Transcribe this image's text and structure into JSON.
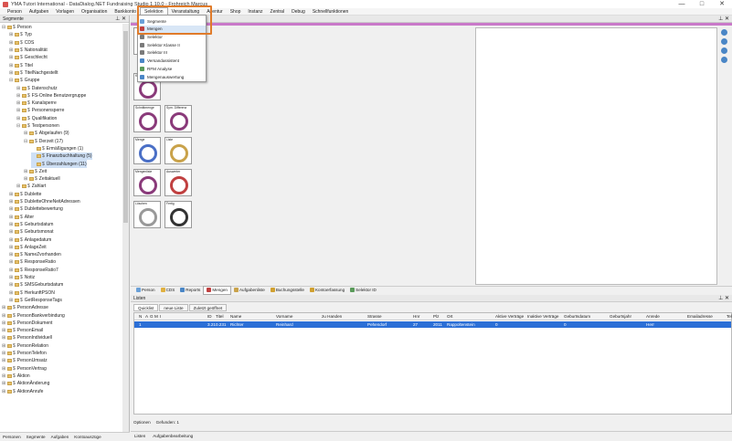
{
  "window": {
    "title": "YMA Tutori International - DataDialog.NET Fundraising Studio 1.10.0 - Frohreich Marcus",
    "controls": [
      "—",
      "□",
      "✕"
    ]
  },
  "menu": {
    "items": [
      "Person",
      "Aufgaben",
      "Vorlagen",
      "Organisation",
      "Bankkonto",
      "Selektion",
      "Veranstaltung",
      "Agentur",
      "Shop",
      "Instanz",
      "Zentral",
      "Debug",
      "Schnellfunktionen"
    ],
    "active_index": 5
  },
  "selektion_menu": {
    "items": [
      {
        "label": "Segmente",
        "icon_color": "#6aa0d8"
      },
      {
        "label": "Mengen",
        "icon_color": "#c04040"
      },
      {
        "label": "Selektor",
        "icon_color": "#7a7a7a"
      },
      {
        "label": "Selektor Klasse II",
        "icon_color": "#7a7a7a"
      },
      {
        "label": "Selektor III",
        "icon_color": "#7a7a7a"
      },
      {
        "label": "Versandassistent",
        "icon_color": "#4a86c6"
      },
      {
        "label": "RFM Analyse",
        "icon_color": "#5a9a5a"
      },
      {
        "label": "Mengenauswertung",
        "icon_color": "#4a86c6"
      }
    ],
    "hot_index": 1
  },
  "left_panel": {
    "title": "Segmente",
    "tree": [
      {
        "label": "Person",
        "depth": 0,
        "exp": "⊟"
      },
      {
        "label": "Typ",
        "depth": 1,
        "exp": "⊞"
      },
      {
        "label": "CDS",
        "depth": 1,
        "exp": "⊞"
      },
      {
        "label": "Nationalität",
        "depth": 1,
        "exp": "⊞"
      },
      {
        "label": "Geschlecht",
        "depth": 1,
        "exp": "⊞"
      },
      {
        "label": "Titel",
        "depth": 1,
        "exp": "⊞"
      },
      {
        "label": "TitelNachgestellt",
        "depth": 1,
        "exp": "⊞"
      },
      {
        "label": "Gruppe",
        "depth": 1,
        "exp": "⊟"
      },
      {
        "label": "Datenschutz",
        "depth": 2,
        "exp": "⊞"
      },
      {
        "label": "FS-Online Benutzergruppe",
        "depth": 2,
        "exp": "⊞"
      },
      {
        "label": "Kanalsperre",
        "depth": 2,
        "exp": "⊞"
      },
      {
        "label": "Personensperre",
        "depth": 2,
        "exp": "⊞"
      },
      {
        "label": "Qualifikation",
        "depth": 2,
        "exp": "⊞"
      },
      {
        "label": "Testpersonen",
        "depth": 2,
        "exp": "⊟"
      },
      {
        "label": "Abgelaufen (9)",
        "depth": 3,
        "exp": "⊞"
      },
      {
        "label": "Derzeit (17)",
        "depth": 3,
        "exp": "⊟"
      },
      {
        "label": "Ermäßigungen (1)",
        "depth": 4,
        "exp": ""
      },
      {
        "label": "Finanzbuchhaltung (5)",
        "depth": 4,
        "exp": "",
        "sel": true
      },
      {
        "label": "Überzahlungen (11)",
        "depth": 4,
        "exp": "",
        "sel": true
      },
      {
        "label": "Zeit",
        "depth": 3,
        "exp": "⊞"
      },
      {
        "label": "Zeitaktuell",
        "depth": 3,
        "exp": "⊞"
      },
      {
        "label": "Zahlart",
        "depth": 2,
        "exp": "⊞"
      },
      {
        "label": "Dublette",
        "depth": 1,
        "exp": "⊞"
      },
      {
        "label": "DubletteOhneNeitAdressen",
        "depth": 1,
        "exp": "⊞"
      },
      {
        "label": "Dublettebewertung",
        "depth": 1,
        "exp": "⊞"
      },
      {
        "label": "Alter",
        "depth": 1,
        "exp": "⊞"
      },
      {
        "label": "Geburtsdatum",
        "depth": 1,
        "exp": "⊞"
      },
      {
        "label": "Geburtsmonat",
        "depth": 1,
        "exp": "⊞"
      },
      {
        "label": "Anlagedatum",
        "depth": 1,
        "exp": "⊞"
      },
      {
        "label": "AnlageZeit",
        "depth": 1,
        "exp": "⊞"
      },
      {
        "label": "NameZvorhanden",
        "depth": 1,
        "exp": "⊞"
      },
      {
        "label": "ResponseRatio",
        "depth": 1,
        "exp": "⊞"
      },
      {
        "label": "ResponseRatio7",
        "depth": 1,
        "exp": "⊞"
      },
      {
        "label": "Notiz",
        "depth": 1,
        "exp": "⊞"
      },
      {
        "label": "SMSGeburtsdatum",
        "depth": 1,
        "exp": "⊞"
      },
      {
        "label": "HerkunftPSON",
        "depth": 1,
        "exp": "⊞"
      },
      {
        "label": "GetResponseTags",
        "depth": 1,
        "exp": "⊞"
      },
      {
        "label": "PersonAdresse",
        "depth": 0,
        "exp": "⊞"
      },
      {
        "label": "PersonBankverbindung",
        "depth": 0,
        "exp": "⊞"
      },
      {
        "label": "PersonDokument",
        "depth": 0,
        "exp": "⊞"
      },
      {
        "label": "PersonEmail",
        "depth": 0,
        "exp": "⊞"
      },
      {
        "label": "PersonIndividuell",
        "depth": 0,
        "exp": "⊞"
      },
      {
        "label": "PersonRelation",
        "depth": 0,
        "exp": "⊞"
      },
      {
        "label": "PersonTelefon",
        "depth": 0,
        "exp": "⊞"
      },
      {
        "label": "PersonUmsatz",
        "depth": 0,
        "exp": "⊞"
      },
      {
        "label": "PersonVertrag",
        "depth": 0,
        "exp": "⊞"
      },
      {
        "label": "Aktion",
        "depth": 0,
        "exp": "⊞"
      },
      {
        "label": "AktionÄnderung",
        "depth": 0,
        "exp": "⊞"
      },
      {
        "label": "AktionAnrufe",
        "depth": 0,
        "exp": "⊞"
      }
    ],
    "bottom_tabs": [
      "Personen",
      "Segmente",
      "Aufgaben",
      "Kontoauszüge"
    ]
  },
  "palette": {
    "tiles": [
      {
        "label": "",
        "col": 0,
        "row": 0,
        "color": "#8a3a7a"
      },
      {
        "label": "Kompl...",
        "col": 0,
        "row": 1,
        "color": "#8a3a7a"
      },
      {
        "label": "Schnittmenge",
        "col": 0,
        "row": 2,
        "color": "#8a3a7a"
      },
      {
        "label": "Sym. Differenz",
        "col": 1,
        "row": 2,
        "color": "#8a3a7a"
      },
      {
        "label": "Menge",
        "col": 0,
        "row": 3,
        "color": "#4a6fc6"
      },
      {
        "label": "Liste",
        "col": 1,
        "row": 3,
        "color": "#c9a24a"
      },
      {
        "label": "Mengenliste",
        "col": 0,
        "row": 4,
        "color": "#8a3a7a"
      },
      {
        "label": "Auswerter",
        "col": 1,
        "row": 4,
        "color": "#c04040"
      },
      {
        "label": "Löschen",
        "col": 0,
        "row": 5,
        "color": "#999999"
      },
      {
        "label": "Fertig",
        "col": 1,
        "row": 5,
        "color": "#333333"
      }
    ]
  },
  "tabstrip": {
    "tabs": [
      {
        "label": "Person",
        "color": "#6aa0d8"
      },
      {
        "label": "CDS",
        "color": "#e0b040"
      },
      {
        "label": "Reports",
        "color": "#4a86c6"
      },
      {
        "label": "Mengen",
        "color": "#c04040",
        "active": true
      },
      {
        "label": "Aufgabenliste",
        "color": "#c9a24a"
      },
      {
        "label": "Buchungsstelle",
        "color": "#d0a030"
      },
      {
        "label": "Kontoerfassung",
        "color": "#d0a030"
      },
      {
        "label": "Selektor ID",
        "color": "#5a9a5a"
      }
    ]
  },
  "lists": {
    "title": "Listen",
    "subtabs": [
      "Quicklist",
      "neue Liste",
      "Zuletzt geöffnet"
    ],
    "headers": [
      "N",
      "A",
      "G",
      "M",
      "I",
      "ID",
      "Titel",
      "Name",
      "Vorname",
      "zu Handen",
      "Strasse",
      "Hnr",
      "Plz",
      "Ort",
      "Aktive Verträge",
      "Inaktive Verträge",
      "Geburtsdatum",
      "Geburtsjahr",
      "Anrede",
      "Emailadresse",
      "Tel"
    ],
    "rows": [
      [
        "1",
        "",
        "",
        "",
        "",
        "3.210.231",
        "",
        "Richter",
        "Reinhard",
        "",
        "Pehendorf",
        "27",
        "2011",
        "Rappoltenstein",
        "0",
        "",
        "0",
        "",
        "Herr",
        "",
        ""
      ]
    ],
    "footer": [
      "Optionen",
      "Gefunden: 1"
    ],
    "bottom_tabs": [
      "Listen",
      "Aufgabenbearbeitung"
    ]
  }
}
